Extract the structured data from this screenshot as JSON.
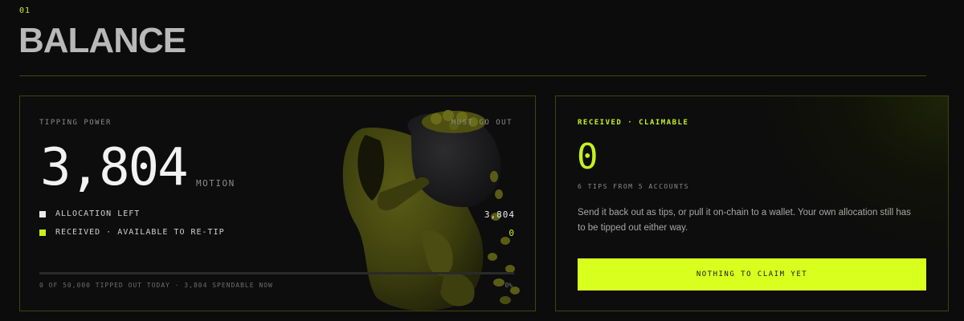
{
  "section": {
    "number": "01",
    "title": "BALANCE"
  },
  "tipping": {
    "label": "TIPPING POWER",
    "badge": "MUST GO OUT",
    "amount": "3,804",
    "unit": "MOTION",
    "legend": [
      {
        "label": "ALLOCATION LEFT",
        "value": "3,804",
        "color": "#eaeaea"
      },
      {
        "label": "RECEIVED · AVAILABLE TO RE-TIP",
        "value": "0",
        "color": "#c8f01e"
      }
    ],
    "progress_fraction": 0,
    "footer": "0 OF 50,000 TIPPED OUT TODAY · 3,804 SPENDABLE NOW",
    "percent": "0%"
  },
  "claim": {
    "label": "RECEIVED · CLAIMABLE",
    "amount": "0",
    "sub": "6 TIPS FROM 5 ACCOUNTS",
    "description": "Send it back out as tips, or pull it on-chain to a wallet. Your own allocation still has to be tipped out either way.",
    "button": "NOTHING TO CLAIM YET"
  },
  "colors": {
    "accent": "#c8f01e",
    "button": "#d9ff1f",
    "background": "#0c0c0c"
  },
  "illustration": "hooded-figure-with-coin-sack-icon"
}
